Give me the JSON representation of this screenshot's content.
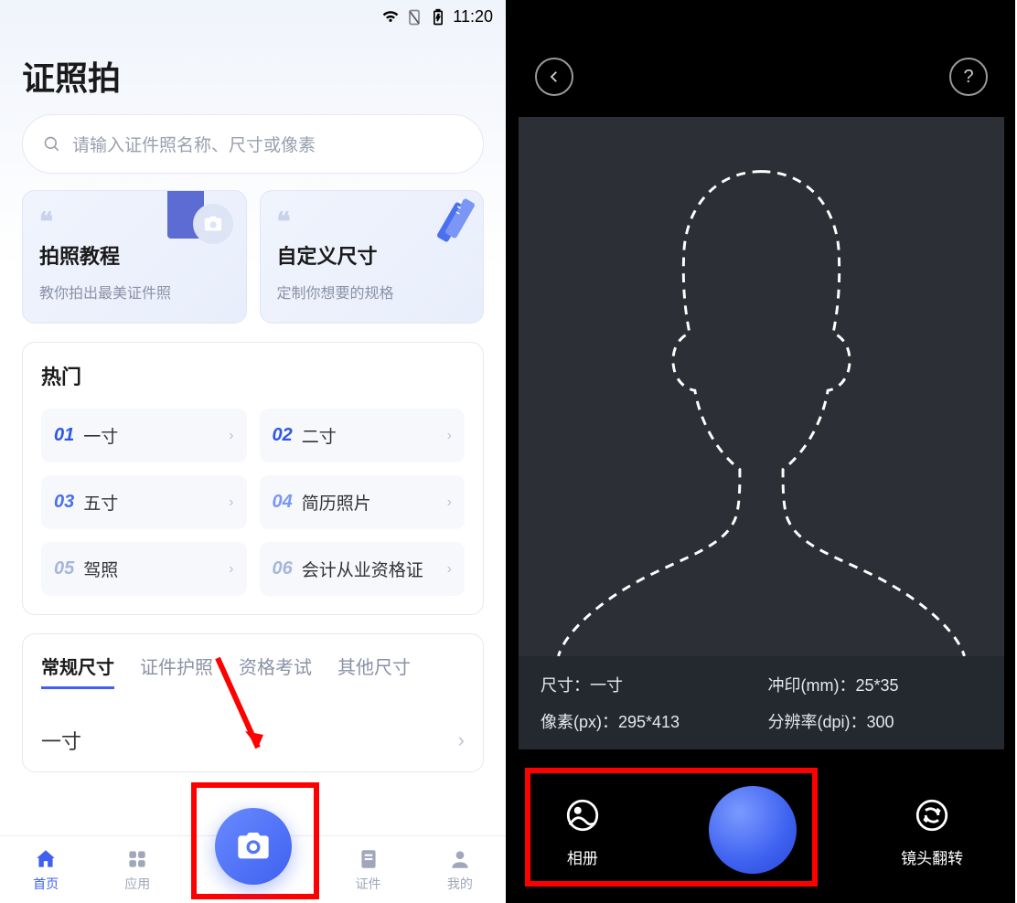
{
  "status": {
    "time": "11:20"
  },
  "left": {
    "app_title": "证照拍",
    "search_placeholder": "请输入证件照名称、尺寸或像素",
    "cards": [
      {
        "title": "拍照教程",
        "subtitle": "教你拍出最美证件照"
      },
      {
        "title": "自定义尺寸",
        "subtitle": "定制你想要的规格"
      }
    ],
    "hot_title": "热门",
    "hot_items": [
      {
        "num": "01",
        "label": "一寸"
      },
      {
        "num": "02",
        "label": "二寸"
      },
      {
        "num": "03",
        "label": "五寸"
      },
      {
        "num": "04",
        "label": "简历照片"
      },
      {
        "num": "05",
        "label": "驾照"
      },
      {
        "num": "06",
        "label": "会计从业资格证"
      }
    ],
    "tabs": [
      {
        "label": "常规尺寸",
        "active": true
      },
      {
        "label": "证件护照",
        "active": false
      },
      {
        "label": "资格考试",
        "active": false
      },
      {
        "label": "其他尺寸",
        "active": false
      }
    ],
    "size_list": [
      {
        "label": "一寸"
      }
    ],
    "nav": [
      {
        "label": "首页",
        "active": true
      },
      {
        "label": "应用",
        "active": false
      },
      {
        "label": "证件",
        "active": false
      },
      {
        "label": "我的",
        "active": false
      }
    ]
  },
  "right": {
    "specs": {
      "size_label": "尺寸：",
      "size_value": "一寸",
      "print_label": "冲印(mm)：",
      "print_value": "25*35",
      "pixel_label": "像素(px)：",
      "pixel_value": "295*413",
      "dpi_label": "分辨率(dpi)：",
      "dpi_value": "300"
    },
    "album_label": "相册",
    "flip_label": "镜头翻转"
  }
}
